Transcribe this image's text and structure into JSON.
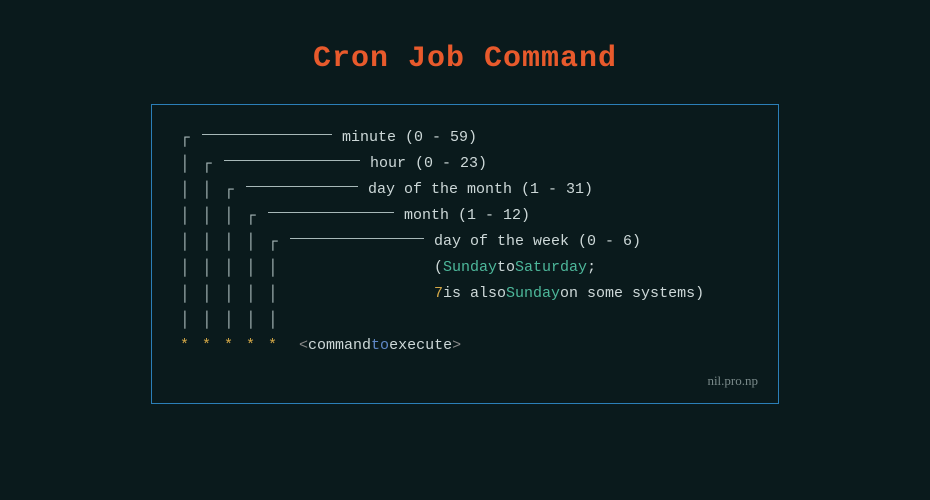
{
  "title": "Cron Job Command",
  "fields": [
    {
      "label": "minute",
      "range": "(0 - 59)"
    },
    {
      "label": "hour",
      "range": "(0 - 23)"
    },
    {
      "label": "day of the month",
      "range": "(1 - 31)"
    },
    {
      "label": "month",
      "range": "(1 - 12)"
    },
    {
      "label": "day of the week",
      "range": "(0 - 6)"
    }
  ],
  "note_line1_open": "(",
  "note_line1_sunday": "Sunday",
  "note_line1_mid": " to ",
  "note_line1_saturday": "Saturday",
  "note_line1_end": ";",
  "note_line2_num": "7",
  "note_line2_a": " is also ",
  "note_line2_sunday": "Sunday",
  "note_line2_b": " on some systems)",
  "stars": "* * * * *",
  "cmd_open": "<",
  "cmd_word1": "command",
  "cmd_to": "to",
  "cmd_word2": "execute",
  "cmd_close": ">",
  "credit": "nil.pro.np"
}
